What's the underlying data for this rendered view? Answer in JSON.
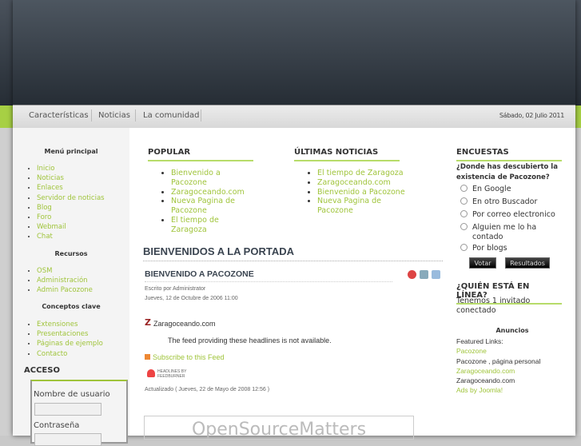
{
  "nav": {
    "items": [
      "Características",
      "Noticias",
      "La comunidad"
    ],
    "date": "Sábado, 02 Julio 2011"
  },
  "left": {
    "menu_title": "Menú principal",
    "menu": [
      "Inicio",
      "Noticias",
      "Enlaces",
      "Servidor de noticias",
      "Blog",
      "Foro",
      "Webmail",
      "Chat"
    ],
    "res_title": "Recursos",
    "res": [
      "OSM",
      "Administración",
      "Admin Pacozone"
    ],
    "con_title": "Conceptos clave",
    "con": [
      "Extensiones",
      "Presentaciones",
      "Páginas de ejemplo",
      "Contacto"
    ],
    "login_title": "ACCESO",
    "user_label": "Nombre de usuario",
    "pass_label": "Contraseña"
  },
  "main": {
    "popular_title": "POPULAR",
    "popular": [
      "Bienvenido a Pacozone",
      "Zaragoceando.com",
      "Nueva Pagina de Pacozone",
      "El tiempo de Zaragoza"
    ],
    "latest_title": "ÚLTIMAS NOTICIAS",
    "latest": [
      "El tiempo de Zaragoza",
      "Zaragoceando.com",
      "Bienvenido a Pacozone",
      "Nueva Pagina de Pacozone"
    ],
    "page_title": "BIENVENIDOS A LA PORTADA",
    "article_title": "BIENVENIDO A PACOZONE",
    "author": "Escrito por Administrator",
    "date": "Jueves, 12 de Octubre de 2006 11:00",
    "feed_name": "Zaragoceando.com",
    "feed_msg": "The feed providing these headlines is not available.",
    "subscribe": "Subscribe to this Feed",
    "feedburner": "HEADLINES BY FEEDBURNER",
    "updated": "Actualizado ( Jueves, 22 de Mayo de 2008 12:56 )",
    "banner": "OpenSourceMatters"
  },
  "right": {
    "poll_title": "ENCUESTAS",
    "question": "¿Donde has descubierto la existencia de Pacozone?",
    "options": [
      "En Google",
      "En otro Buscador",
      "Por correo electronico",
      "Alguien me lo ha contado",
      "Por blogs"
    ],
    "vote": "Votar",
    "results": "Resultados",
    "online_title": "¿QUIÉN ESTÁ EN LÍNEA?",
    "online_text": "Tenemos 1 invitado conectado",
    "ads_title": "Anuncios",
    "ads": [
      {
        "text": "Featured Links:",
        "link": false
      },
      {
        "text": "Pacozone",
        "link": true
      },
      {
        "text": "Pacozone , página personal",
        "link": false
      },
      {
        "text": "Zaragoceando.com",
        "link": true
      },
      {
        "text": "Zaragoceando.com",
        "link": false
      },
      {
        "text": "Ads by Joomla!",
        "link": true
      }
    ]
  }
}
